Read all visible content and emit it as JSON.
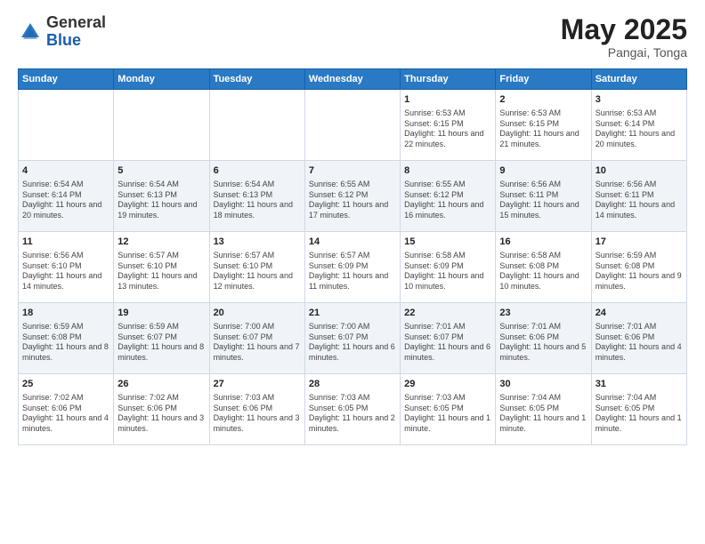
{
  "logo": {
    "general": "General",
    "blue": "Blue"
  },
  "title": {
    "month_year": "May 2025",
    "location": "Pangai, Tonga"
  },
  "weekdays": [
    "Sunday",
    "Monday",
    "Tuesday",
    "Wednesday",
    "Thursday",
    "Friday",
    "Saturday"
  ],
  "weeks": [
    [
      {
        "day": "",
        "info": ""
      },
      {
        "day": "",
        "info": ""
      },
      {
        "day": "",
        "info": ""
      },
      {
        "day": "",
        "info": ""
      },
      {
        "day": "1",
        "info": "Sunrise: 6:53 AM\nSunset: 6:15 PM\nDaylight: 11 hours and 22 minutes."
      },
      {
        "day": "2",
        "info": "Sunrise: 6:53 AM\nSunset: 6:15 PM\nDaylight: 11 hours and 21 minutes."
      },
      {
        "day": "3",
        "info": "Sunrise: 6:53 AM\nSunset: 6:14 PM\nDaylight: 11 hours and 20 minutes."
      }
    ],
    [
      {
        "day": "4",
        "info": "Sunrise: 6:54 AM\nSunset: 6:14 PM\nDaylight: 11 hours and 20 minutes."
      },
      {
        "day": "5",
        "info": "Sunrise: 6:54 AM\nSunset: 6:13 PM\nDaylight: 11 hours and 19 minutes."
      },
      {
        "day": "6",
        "info": "Sunrise: 6:54 AM\nSunset: 6:13 PM\nDaylight: 11 hours and 18 minutes."
      },
      {
        "day": "7",
        "info": "Sunrise: 6:55 AM\nSunset: 6:12 PM\nDaylight: 11 hours and 17 minutes."
      },
      {
        "day": "8",
        "info": "Sunrise: 6:55 AM\nSunset: 6:12 PM\nDaylight: 11 hours and 16 minutes."
      },
      {
        "day": "9",
        "info": "Sunrise: 6:56 AM\nSunset: 6:11 PM\nDaylight: 11 hours and 15 minutes."
      },
      {
        "day": "10",
        "info": "Sunrise: 6:56 AM\nSunset: 6:11 PM\nDaylight: 11 hours and 14 minutes."
      }
    ],
    [
      {
        "day": "11",
        "info": "Sunrise: 6:56 AM\nSunset: 6:10 PM\nDaylight: 11 hours and 14 minutes."
      },
      {
        "day": "12",
        "info": "Sunrise: 6:57 AM\nSunset: 6:10 PM\nDaylight: 11 hours and 13 minutes."
      },
      {
        "day": "13",
        "info": "Sunrise: 6:57 AM\nSunset: 6:10 PM\nDaylight: 11 hours and 12 minutes."
      },
      {
        "day": "14",
        "info": "Sunrise: 6:57 AM\nSunset: 6:09 PM\nDaylight: 11 hours and 11 minutes."
      },
      {
        "day": "15",
        "info": "Sunrise: 6:58 AM\nSunset: 6:09 PM\nDaylight: 11 hours and 10 minutes."
      },
      {
        "day": "16",
        "info": "Sunrise: 6:58 AM\nSunset: 6:08 PM\nDaylight: 11 hours and 10 minutes."
      },
      {
        "day": "17",
        "info": "Sunrise: 6:59 AM\nSunset: 6:08 PM\nDaylight: 11 hours and 9 minutes."
      }
    ],
    [
      {
        "day": "18",
        "info": "Sunrise: 6:59 AM\nSunset: 6:08 PM\nDaylight: 11 hours and 8 minutes."
      },
      {
        "day": "19",
        "info": "Sunrise: 6:59 AM\nSunset: 6:07 PM\nDaylight: 11 hours and 8 minutes."
      },
      {
        "day": "20",
        "info": "Sunrise: 7:00 AM\nSunset: 6:07 PM\nDaylight: 11 hours and 7 minutes."
      },
      {
        "day": "21",
        "info": "Sunrise: 7:00 AM\nSunset: 6:07 PM\nDaylight: 11 hours and 6 minutes."
      },
      {
        "day": "22",
        "info": "Sunrise: 7:01 AM\nSunset: 6:07 PM\nDaylight: 11 hours and 6 minutes."
      },
      {
        "day": "23",
        "info": "Sunrise: 7:01 AM\nSunset: 6:06 PM\nDaylight: 11 hours and 5 minutes."
      },
      {
        "day": "24",
        "info": "Sunrise: 7:01 AM\nSunset: 6:06 PM\nDaylight: 11 hours and 4 minutes."
      }
    ],
    [
      {
        "day": "25",
        "info": "Sunrise: 7:02 AM\nSunset: 6:06 PM\nDaylight: 11 hours and 4 minutes."
      },
      {
        "day": "26",
        "info": "Sunrise: 7:02 AM\nSunset: 6:06 PM\nDaylight: 11 hours and 3 minutes."
      },
      {
        "day": "27",
        "info": "Sunrise: 7:03 AM\nSunset: 6:06 PM\nDaylight: 11 hours and 3 minutes."
      },
      {
        "day": "28",
        "info": "Sunrise: 7:03 AM\nSunset: 6:05 PM\nDaylight: 11 hours and 2 minutes."
      },
      {
        "day": "29",
        "info": "Sunrise: 7:03 AM\nSunset: 6:05 PM\nDaylight: 11 hours and 1 minute."
      },
      {
        "day": "30",
        "info": "Sunrise: 7:04 AM\nSunset: 6:05 PM\nDaylight: 11 hours and 1 minute."
      },
      {
        "day": "31",
        "info": "Sunrise: 7:04 AM\nSunset: 6:05 PM\nDaylight: 11 hours and 1 minute."
      }
    ]
  ]
}
